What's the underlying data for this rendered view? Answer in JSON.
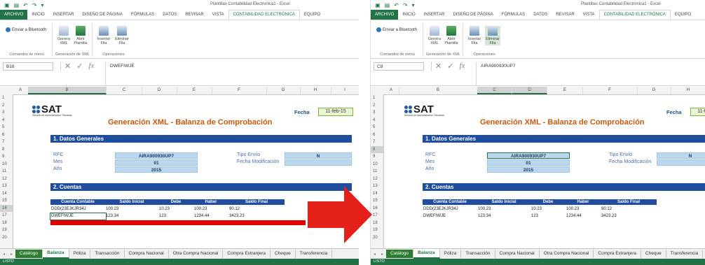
{
  "window_title": "Plantillas Contabilidad Electronica1 - Excel",
  "ribbon_tabs": [
    "ARCHIVO",
    "INICIO",
    "INSERTAR",
    "DISEÑO DE PÁGINA",
    "FÓRMULAS",
    "DATOS",
    "REVISAR",
    "VISTA",
    "CONTABILIDAD ELECTRÓNICA",
    "EQUIPO"
  ],
  "active_tab": "CONTABILIDAD ELECTRÓNICA",
  "ribbon": {
    "bluetooth_label": "Enviar a Bluetooth",
    "groups": [
      "Comandos de menú",
      "Generación de XML",
      "Operaciones"
    ],
    "buttons": [
      {
        "label": "Genera XML"
      },
      {
        "label": "Abrir Plantilla"
      },
      {
        "label": "Insertar Fila"
      },
      {
        "label": "Eliminar Fila"
      }
    ]
  },
  "colors": {
    "excel_green": "#217346",
    "header_blue": "#1f4e9e",
    "title_orange": "#c55a11",
    "value_blue": "#bdd7ee",
    "arrow_red": "#e32119"
  },
  "column_headers": [
    "A",
    "B",
    "C",
    "D",
    "E",
    "F",
    "G",
    "H",
    "I"
  ],
  "row_numbers": [
    "1",
    "2",
    "3",
    "4",
    "5",
    "6",
    "7",
    "8",
    "9",
    "10",
    "11",
    "12",
    "13",
    "14",
    "15",
    "16",
    "17",
    "18",
    "19",
    "20"
  ],
  "sheet": {
    "sat_logo": "SAT",
    "sat_subtitle": "Servicio de Administración Tributaria",
    "title": "Generación XML - Balanza de Comprobación",
    "fecha_label": "Fecha",
    "fecha_value": "11-feb-15",
    "section1": "1. Datos Generales",
    "rfc_label": "RFC",
    "rfc_value": "AIRA900930UP7",
    "mes_label": "Mes",
    "mes_value": "01",
    "anio_label": "Año",
    "anio_value": "2015",
    "tipo_envio_label": "Tipo Envío",
    "tipo_envio_value": "N",
    "fecha_mod_label": "Fecha Modificación",
    "section2": "2. Cuentas",
    "table_headers": [
      "Cuenta Contable",
      "Saldo Inicial",
      "Debe",
      "Haber",
      "Saldo Final"
    ],
    "rows": [
      [
        "DDD(23EJKJR34J",
        "100.23",
        "10.23",
        "100.23",
        "90.12"
      ],
      [
        "DWEFIWJE",
        "123.34",
        "123",
        "1234.44",
        "3423.23"
      ]
    ]
  },
  "sheet_tabs": [
    "Catálogo",
    "Balanza",
    "Póliza",
    "Transacción",
    "Compra Nacional",
    "Otra Compra Nacional",
    "Compra Extranjera",
    "Cheque",
    "Transferencia"
  ],
  "active_sheet_tab": "Balanza",
  "status_text": "LISTO",
  "left_window": {
    "name_box": "B16",
    "formula": "DWEFIWJE"
  },
  "right_window": {
    "name_box": "C8",
    "formula": "AIRA900930UP7"
  }
}
